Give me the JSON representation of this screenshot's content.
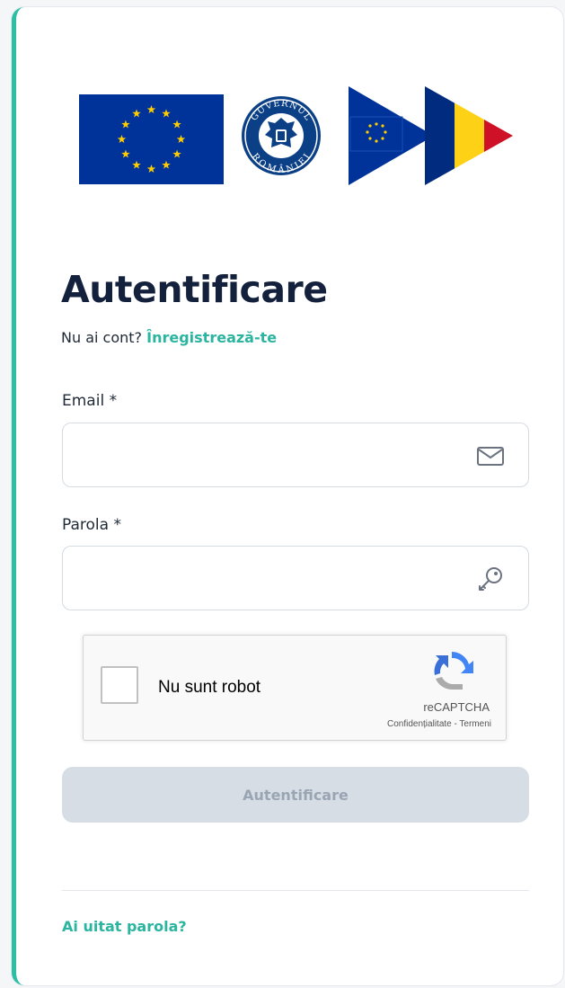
{
  "logos": {
    "eu_flag": "eu-flag",
    "government_seal": "governul-romaniei-seal",
    "seal_text_top": "GUVERNUL",
    "seal_text_bottom": "ROMÂNIEI"
  },
  "login": {
    "title": "Autentificare",
    "no_account_text": "Nu ai cont?",
    "register_link": "Înregistrează-te",
    "email_label": "Email *",
    "email_value": "",
    "password_label": "Parola *",
    "password_value": "",
    "submit_label": "Autentificare",
    "forgot_password": "Ai uitat parola?"
  },
  "captcha": {
    "label": "Nu sunt robot",
    "brand": "reCAPTCHA",
    "terms": "Confidențialitate - Termeni"
  },
  "icons": {
    "email": "envelope-icon",
    "password": "key-icon",
    "captcha": "recaptcha-logo-icon"
  },
  "colors": {
    "accent": "#2bb5a0",
    "title": "#14213d",
    "button_disabled": "#d7dde5",
    "eu_blue": "#003399",
    "eu_gold": "#ffcc00",
    "ro_blue": "#002b7f",
    "ro_yellow": "#fcd116",
    "ro_red": "#ce1126"
  }
}
